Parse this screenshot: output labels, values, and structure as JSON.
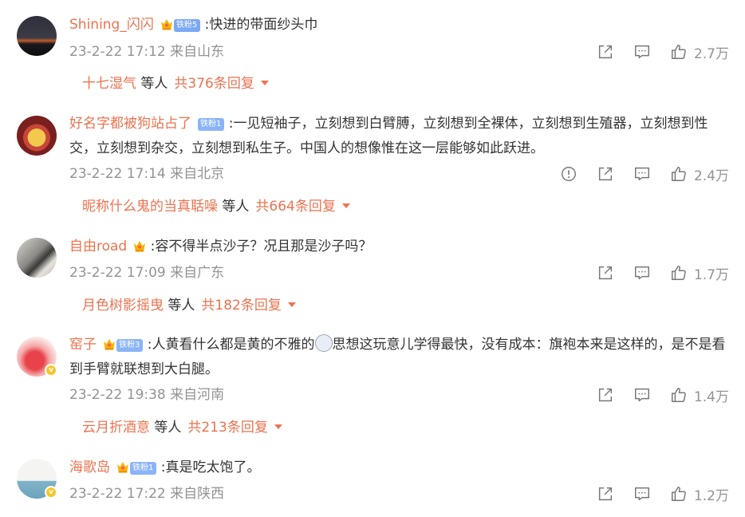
{
  "colors": {
    "accent": "#eb7350",
    "meta": "#939393",
    "text": "#333333",
    "fan_badge": "#8ab4f8"
  },
  "comments": [
    {
      "username": "Shining_闪闪",
      "fan_badge": "铁粉5",
      "text": ":快进的带面纱头巾",
      "time": "23-2-22 17:12 来自山东",
      "likes": "2.7万",
      "reply_user": "十七湿气",
      "reply_mid": "等人",
      "reply_count": "共376条回复"
    },
    {
      "username": "好名字都被狗站占了",
      "fan_badge": "铁粉1",
      "text": ":一见短袖子，立刻想到白臂膊，立刻想到全裸体，立刻想到生殖器，立刻想到性交，立刻想到杂交，立刻想到私生子。中国人的想像惟在这一层能够如此跃进。",
      "time": "23-2-22 17:14 来自北京",
      "likes": "2.4万",
      "reply_user": "昵称什么鬼的当真聒噪",
      "reply_mid": "等人",
      "reply_count": "共664条回复"
    },
    {
      "username": "自由road",
      "text": ":容不得半点沙子？况且那是沙子吗？",
      "time": "23-2-22 17:09 来自广东",
      "likes": "1.7万",
      "reply_user": "月色树影摇曳",
      "reply_mid": "等人",
      "reply_count": "共182条回复"
    },
    {
      "username": "窑子",
      "fan_badge": "铁粉3",
      "text_before": ":人黄看什么都是黄的不雅的",
      "text_after": "思想这玩意儿学得最快，没有成本：旗袍本来是这样的，是不是看到手臂就联想到大白腿。",
      "time": "23-2-22 19:38 来自河南",
      "likes": "1.4万",
      "reply_user": "云月折酒意",
      "reply_mid": "等人",
      "reply_count": "共213条回复"
    },
    {
      "username": "海歌岛",
      "fan_badge": "铁粉1",
      "text": ":真是吃太饱了。",
      "time": "23-2-22 17:22 来自陕西",
      "likes": "1.2万"
    }
  ],
  "icons": {
    "share": "share-icon",
    "comment": "comment-icon",
    "like": "like-icon",
    "report": "report-icon",
    "expand": "caret-down-icon"
  }
}
